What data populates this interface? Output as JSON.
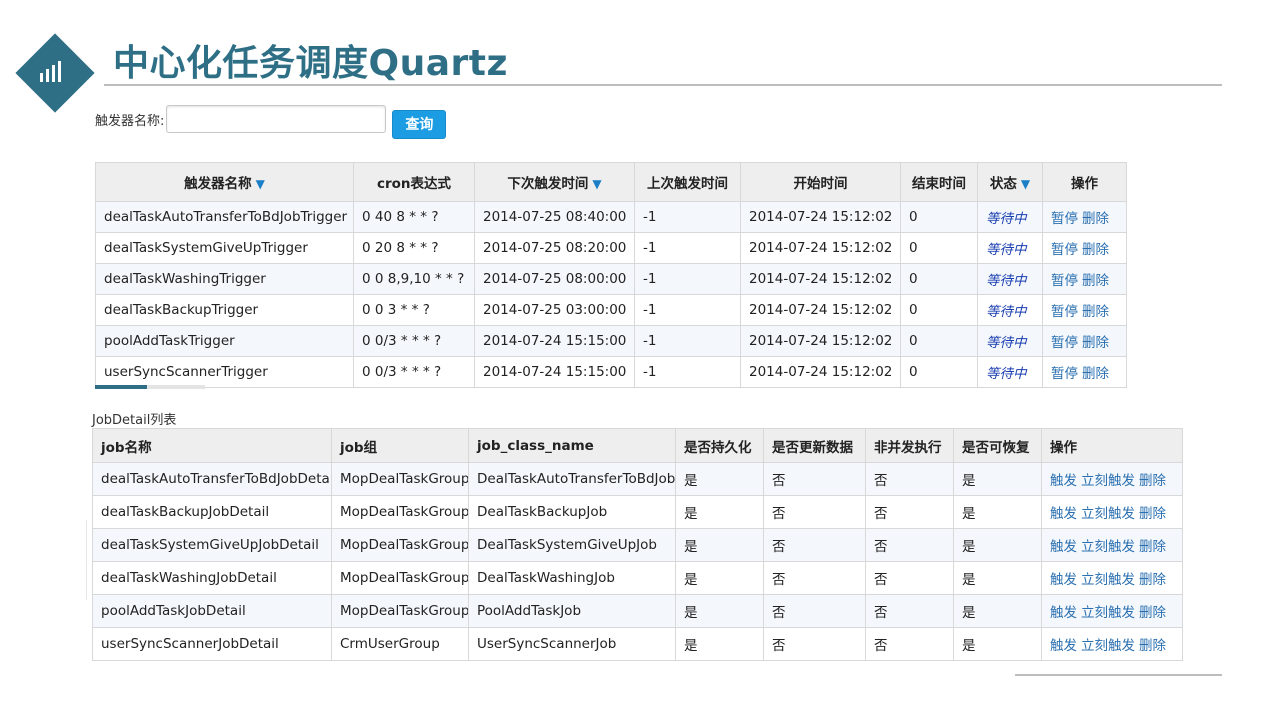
{
  "header": {
    "title": "中心化任务调度Quartz",
    "logo_icon": "bar-chart-icon",
    "accent_color": "#2e6f86"
  },
  "search": {
    "label": "触发器名称:",
    "value": "",
    "placeholder": "",
    "button_label": "查询",
    "button_color": "#1c9de3"
  },
  "triggers": {
    "headers": [
      "触发器名称",
      "cron表达式",
      "下次触发时间",
      "上次触发时间",
      "开始时间",
      "结束时间",
      "状态",
      "操作"
    ],
    "sort_icon": "sort-desc-icon",
    "rows": [
      {
        "name": "dealTaskAutoTransferToBdJobTrigger",
        "cron": "0 40 8 * * ?",
        "next": "2014-07-25 08:40:00",
        "prev": "-1",
        "start": "2014-07-24 15:12:02",
        "end": "0",
        "status": "等待中",
        "op_pause": "暂停",
        "op_delete": "删除"
      },
      {
        "name": "dealTaskSystemGiveUpTrigger",
        "cron": "0 20 8 * * ?",
        "next": "2014-07-25 08:20:00",
        "prev": "-1",
        "start": "2014-07-24 15:12:02",
        "end": "0",
        "status": "等待中",
        "op_pause": "暂停",
        "op_delete": "删除"
      },
      {
        "name": "dealTaskWashingTrigger",
        "cron": "0 0 8,9,10 * * ?",
        "next": "2014-07-25 08:00:00",
        "prev": "-1",
        "start": "2014-07-24 15:12:02",
        "end": "0",
        "status": "等待中",
        "op_pause": "暂停",
        "op_delete": "删除"
      },
      {
        "name": "dealTaskBackupTrigger",
        "cron": "0 0 3 * * ?",
        "next": "2014-07-25 03:00:00",
        "prev": "-1",
        "start": "2014-07-24 15:12:02",
        "end": "0",
        "status": "等待中",
        "op_pause": "暂停",
        "op_delete": "删除"
      },
      {
        "name": "poolAddTaskTrigger",
        "cron": "0 0/3 * * * ?",
        "next": "2014-07-24 15:15:00",
        "prev": "-1",
        "start": "2014-07-24 15:12:02",
        "end": "0",
        "status": "等待中",
        "op_pause": "暂停",
        "op_delete": "删除"
      },
      {
        "name": "userSyncScannerTrigger",
        "cron": "0 0/3 * * * ?",
        "next": "2014-07-24 15:15:00",
        "prev": "-1",
        "start": "2014-07-24 15:12:02",
        "end": "0",
        "status": "等待中",
        "op_pause": "暂停",
        "op_delete": "删除"
      }
    ]
  },
  "jobdetails": {
    "caption": "JobDetail列表",
    "headers": [
      "job名称",
      "job组",
      "job_class_name",
      "是否持久化",
      "是否更新数据",
      "非并发执行",
      "是否可恢复",
      "操作"
    ],
    "rows": [
      {
        "name": "dealTaskAutoTransferToBdJobDetail",
        "group": "MopDealTaskGroup",
        "cls": "DealTaskAutoTransferToBdJob",
        "durable": "是",
        "update": "否",
        "nonconcurrent": "否",
        "recover": "是",
        "op_trigger": "触发",
        "op_now": "立刻触发",
        "op_delete": "删除"
      },
      {
        "name": "dealTaskBackupJobDetail",
        "group": "MopDealTaskGroup",
        "cls": "DealTaskBackupJob",
        "durable": "是",
        "update": "否",
        "nonconcurrent": "否",
        "recover": "是",
        "op_trigger": "触发",
        "op_now": "立刻触发",
        "op_delete": "删除"
      },
      {
        "name": "dealTaskSystemGiveUpJobDetail",
        "group": "MopDealTaskGroup",
        "cls": "DealTaskSystemGiveUpJob",
        "durable": "是",
        "update": "否",
        "nonconcurrent": "否",
        "recover": "是",
        "op_trigger": "触发",
        "op_now": "立刻触发",
        "op_delete": "删除"
      },
      {
        "name": "dealTaskWashingJobDetail",
        "group": "MopDealTaskGroup",
        "cls": "DealTaskWashingJob",
        "durable": "是",
        "update": "否",
        "nonconcurrent": "否",
        "recover": "是",
        "op_trigger": "触发",
        "op_now": "立刻触发",
        "op_delete": "删除"
      },
      {
        "name": "poolAddTaskJobDetail",
        "group": "MopDealTaskGroup",
        "cls": "PoolAddTaskJob",
        "durable": "是",
        "update": "否",
        "nonconcurrent": "否",
        "recover": "是",
        "op_trigger": "触发",
        "op_now": "立刻触发",
        "op_delete": "删除"
      },
      {
        "name": "userSyncScannerJobDetail",
        "group": "CrmUserGroup",
        "cls": "UserSyncScannerJob",
        "durable": "是",
        "update": "否",
        "nonconcurrent": "否",
        "recover": "是",
        "op_trigger": "触发",
        "op_now": "立刻触发",
        "op_delete": "删除"
      }
    ]
  }
}
